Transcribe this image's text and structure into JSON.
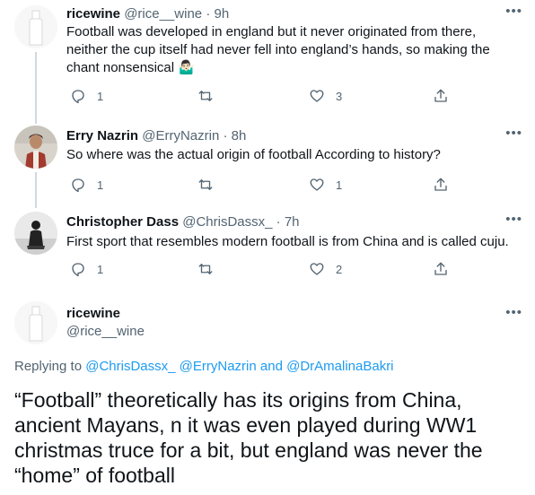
{
  "tweets": [
    {
      "name": "ricewine",
      "handle": "@rice__wine",
      "time": "9h",
      "text": "Football was developed in england but it never originated from there, neither the cup itself had never fell into england’s hands, so making the chant nonsensical 🤷🏻‍♂️",
      "replies": "1",
      "retweets": "",
      "likes": "3"
    },
    {
      "name": "Erry Nazrin",
      "handle": "@ErryNazrin",
      "time": "8h",
      "text": "So where was the actual origin of football According to history?",
      "replies": "1",
      "retweets": "",
      "likes": "1"
    },
    {
      "name": "Christopher Dass",
      "handle": "@ChrisDassx_",
      "time": "7h",
      "text": "First sport that resembles modern football is from China and is called cuju.",
      "replies": "1",
      "retweets": "",
      "likes": "2"
    }
  ],
  "main": {
    "name": "ricewine",
    "handle": "@rice__wine",
    "replying_prefix": "Replying to",
    "mention1": "@ChrisDassx_",
    "mention2": "@ErryNazrin",
    "and": "and",
    "mention3": "@DrAmalinaBakri",
    "text": "“Football” theoretically has its origins from China, ancient Mayans, n it was even played during WW1 christmas truce for a bit, but england was never the “home” of football"
  },
  "icons": {
    "reply": "reply-icon",
    "retweet": "retweet-icon",
    "like": "heart-icon",
    "share": "share-icon",
    "more": "more-icon"
  },
  "colors": {
    "text": "#0f1419",
    "secondary": "#536471",
    "link": "#1d9bf0",
    "thread_line": "#cfd9de"
  }
}
